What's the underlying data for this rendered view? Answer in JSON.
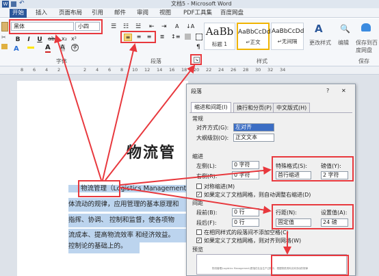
{
  "title_bar": {
    "title": "文档5 - Microsoft Word"
  },
  "ribbon_tabs": [
    "开始",
    "插入",
    "页面布局",
    "引用",
    "邮件",
    "审阅",
    "视图",
    "PDF工具集",
    "百度网盘"
  ],
  "font": {
    "name": "黑体",
    "size": "小四"
  },
  "font_buttons": {
    "bold": "B",
    "italic": "I",
    "underline": "U"
  },
  "groups": {
    "font": "字体",
    "paragraph": "段落",
    "styles": "样式"
  },
  "styles": [
    {
      "preview": "AaBb",
      "label": "标题 1"
    },
    {
      "preview": "AaBbCcDd",
      "label": "↵正文"
    },
    {
      "preview": "AaBbCcDd",
      "label": "↵无间隔"
    }
  ],
  "right_buttons": {
    "change_styles": "更改样式",
    "edit": "编辑",
    "save_to_baidu_1": "保存到百",
    "save_to_baidu_2": "度网盘",
    "save_to_baidu_3": "保存"
  },
  "ruler_numbers": [
    "8",
    "6",
    "4",
    "2",
    "",
    "2",
    "4",
    "6",
    "8",
    "10",
    "12",
    "14",
    "16",
    "18",
    "20",
    "22",
    "24",
    "26",
    "28",
    "30",
    "32",
    "34"
  ],
  "document": {
    "title": "物流管",
    "lines": [
      {
        "highlight": "物流管理",
        "rest": "（Logistics Management"
      },
      {
        "text": "体流动的规律，应用管理的基本原理和"
      },
      {
        "text": "指挥、协调、 控制和监督，使各项物"
      },
      {
        "text": "流成本、提高物流效率 和经济效益。"
      },
      {
        "text": "控制论的基础上的。"
      }
    ]
  },
  "dialog": {
    "title": "段落",
    "help": "?",
    "close": "✕",
    "tabs": [
      "缩进和间距(I)",
      "换行和分页(P)",
      "中文版式(H)"
    ],
    "general": {
      "heading": "常规",
      "alignment_label": "对齐方式(G):",
      "alignment_value": "左对齐",
      "outline_label": "大纲级别(O):",
      "outline_value": "正文文本"
    },
    "indent": {
      "heading": "缩进",
      "left_label": "左侧(L):",
      "left_value": "0 字符",
      "right_label": "右侧(R):",
      "right_value": "0 字符",
      "special_label": "特殊格式(S):",
      "special_value": "首行缩进",
      "by_label": "磅值(Y):",
      "by_value": "2 字符",
      "mirror_label": "对称缩进(M)",
      "auto_label": "如果定义了文档网格，则自动调整右缩进(D)"
    },
    "spacing": {
      "heading": "间距",
      "before_label": "段前(B):",
      "before_value": "0 行",
      "after_label": "段后(F):",
      "after_value": "0 行",
      "line_label": "行距(N):",
      "line_value": "固定值",
      "at_label": "设置值(A):",
      "at_value": "24 磅",
      "no_space_label": "在相同样式的段落间不添加空格(C)",
      "snap_label": "如果定义了文档网格，则对齐到网格(W)"
    },
    "preview": {
      "heading": "预览",
      "text": "物流管理(Logistics Management)是指在社会生产过程中，根据物质资料实体流动的规律"
    }
  },
  "colors": {
    "accent": "#2b579a",
    "highlight_box": "#e8383d",
    "selection": "#bcd4ee"
  }
}
